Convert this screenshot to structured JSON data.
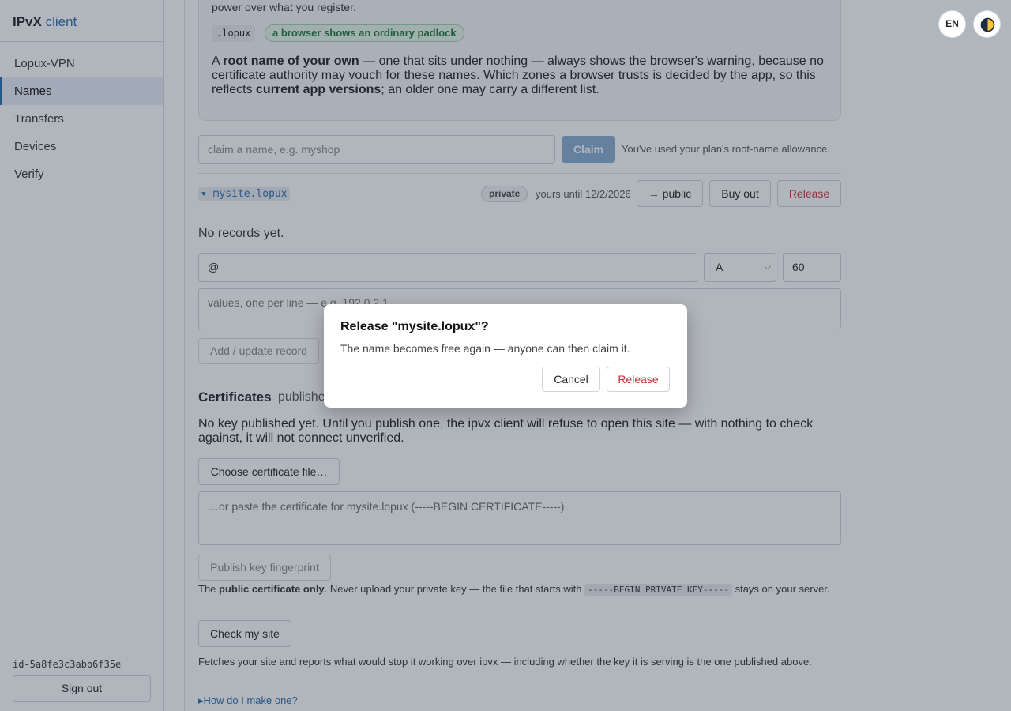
{
  "brand": {
    "name": "IPvX",
    "accent": "client"
  },
  "sidebar": {
    "items": [
      {
        "label": "Lopux-VPN"
      },
      {
        "label": "Names"
      },
      {
        "label": "Transfers"
      },
      {
        "label": "Devices"
      },
      {
        "label": "Verify"
      }
    ],
    "user_id": "id-5a8fe3c3abb6f35e",
    "signout_label": "Sign out"
  },
  "topbar": {
    "lang_label": "EN",
    "theme_icon": "half-moon-icon"
  },
  "info": {
    "top_line": "power over what you register.",
    "zone_chip": ".lopux",
    "zone_pill": "a browser shows an ordinary padlock",
    "para": {
      "a": "A ",
      "b": "root name of your own",
      "c": " — one that sits under nothing — always shows the browser's warning, because no certificate authority may vouch for these names. Which zones a browser trusts is decided by the app, so this reflects ",
      "d": "current app versions",
      "e": "; an older one may carry a different list."
    }
  },
  "claim": {
    "placeholder": "claim a name, e.g. myshop",
    "button": "Claim",
    "note": "You've used your plan's root-name allowance."
  },
  "name_row": {
    "name": "mysite.lopux",
    "visibility": "private",
    "until": "yours until 12/2/2026",
    "public_button": "→ public",
    "buyout_button": "Buy out",
    "release_button": "Release"
  },
  "records": {
    "empty": "No records yet.",
    "name_value": "@",
    "type_value": "A",
    "ttl_value": "60",
    "values_placeholder": "values, one per line — e.g. 192.0.2.1",
    "add_button": "Add / update record"
  },
  "certs": {
    "title": "Certificates",
    "subtitle": "publishe",
    "para": "No key published yet. Until you publish one, the ipvx client will refuse to open this site — with nothing to check against, it will not connect unverified.",
    "choose_button": "Choose certificate file…",
    "paste_placeholder": "…or paste the certificate for mysite.lopux (-----BEGIN CERTIFICATE-----)",
    "publish_button": "Publish key fingerprint",
    "pk_note": {
      "a": "The ",
      "b": "public certificate only",
      "c": ". Never upload your private key — the file that starts with ",
      "d": "-----BEGIN PRIVATE KEY-----",
      "e": " stays on your server."
    },
    "check_button": "Check my site",
    "fetch_note": "Fetches your site and reports what would stop it working over ipvx — including whether the key it is serving is the one published above.",
    "howto": "How do I make one?"
  },
  "dialog": {
    "title": "Release \"mysite.lopux\"?",
    "body": "The name becomes free again — anyone can then claim it.",
    "cancel": "Cancel",
    "confirm": "Release"
  },
  "colors": {
    "accent": "#2b6cb0",
    "danger": "#c53030",
    "success": "#1c7a35"
  }
}
